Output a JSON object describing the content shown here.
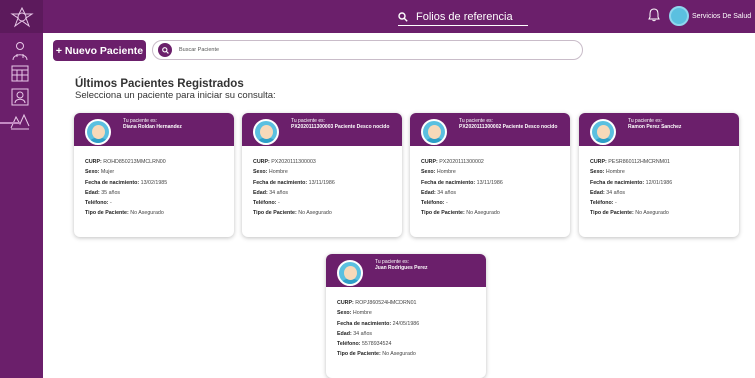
{
  "header": {
    "ref_search_label": "Folios de referencia",
    "user_name": "Servicios De Salud"
  },
  "toolbar": {
    "new_patient_label": "+ Nuevo Paciente",
    "search_placeholder": "Buscar Paciente"
  },
  "main": {
    "title": "Últimos Pacientes Registrados",
    "subtitle": "Selecciona un paciente para iniciar su consulta:"
  },
  "field_labels": {
    "curp": "CURP:",
    "sexo": "Sexo:",
    "fecha": "Fecha de nacimiento:",
    "edad": "Edad:",
    "telefono": "Teléfono:",
    "tipo": "Tipo de Paciente:"
  },
  "patients": [
    {
      "header_label": "Tu paciente es:",
      "name": "Diana Roldan Hernandez",
      "curp": "ROHD850213MMCLRN00",
      "sexo": "Mujer",
      "fecha": "13/02/1985",
      "edad": "35 años",
      "telefono": "-",
      "tipo": "No Asegurado"
    },
    {
      "header_label": "Tu paciente es:",
      "name": "PX2020111300003 Paciente Desco nocido",
      "curp": "PX2020111300003",
      "sexo": "Hombre",
      "fecha": "13/11/1986",
      "edad": "34 años",
      "telefono": "-",
      "tipo": "No Asegurado"
    },
    {
      "header_label": "Tu paciente es:",
      "name": "PX2020111300002 Paciente Desco nocido",
      "curp": "PX2020111300002",
      "sexo": "Hombre",
      "fecha": "13/11/1986",
      "edad": "34 años",
      "telefono": "-",
      "tipo": "No Asegurado"
    },
    {
      "header_label": "Tu paciente es:",
      "name": "Ramon Perez Sanchez",
      "curp": "PESR860112HMCRNM01",
      "sexo": "Hombre",
      "fecha": "12/01/1986",
      "edad": "34 años",
      "telefono": "-",
      "tipo": "No Asegurado"
    },
    {
      "header_label": "Tu paciente es:",
      "name": "Juan Rodrigues Perez",
      "curp": "ROPJ860524HMCDRN01",
      "sexo": "Hombre",
      "fecha": "24/05/1986",
      "edad": "34 años",
      "telefono": "5578934524",
      "tipo": "No Asegurado"
    }
  ],
  "colors": {
    "brand": "#6b1f6b",
    "avatar": "#5bc0e0"
  }
}
